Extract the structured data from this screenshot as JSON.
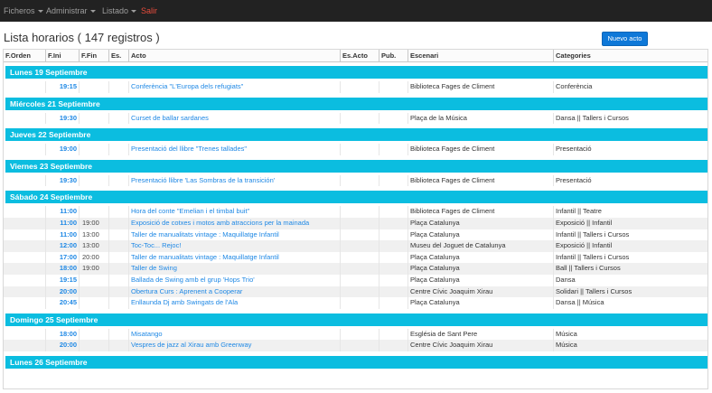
{
  "navbar": {
    "items": [
      {
        "label": "Ficheros",
        "dropdown": true
      },
      {
        "label": "Administrar",
        "dropdown": true
      },
      {
        "label": "Listado",
        "dropdown": true
      },
      {
        "label": "Salir",
        "dropdown": false
      }
    ]
  },
  "page": {
    "title": "Lista horarios ( 147 registros )",
    "new_button": "Nuevo acto"
  },
  "table": {
    "headers": [
      "F.Orden",
      "F.Ini",
      "F.Fin",
      "Es.",
      "Acto",
      "Es.Acto",
      "Pub.",
      "Escenari",
      "Categories"
    ],
    "groups": [
      {
        "day": "Lunes 19 Septiembre",
        "rows": [
          {
            "ini": "19:15",
            "fin": "",
            "acto": "Conferència \"L'Europa dels refugiats\"",
            "escenari": "Biblioteca Fages de Climent",
            "categories": "Conferència"
          }
        ]
      },
      {
        "day": "Miércoles 21 Septiembre",
        "rows": [
          {
            "ini": "19:30",
            "fin": "",
            "acto": "Curset de ballar sardanes",
            "escenari": "Plaça de la Música",
            "categories": "Dansa || Tallers i Cursos"
          }
        ]
      },
      {
        "day": "Jueves 22 Septiembre",
        "rows": [
          {
            "ini": "19:00",
            "fin": "",
            "acto": "Presentació del llibre \"Trenes tallades\"",
            "escenari": "Biblioteca Fages de Climent",
            "categories": "Presentació"
          }
        ]
      },
      {
        "day": "Viernes 23 Septiembre",
        "rows": [
          {
            "ini": "19:30",
            "fin": "",
            "acto": "Presentació llibre 'Las Sombras de la transición'",
            "escenari": "Biblioteca Fages de Climent",
            "categories": "Presentació"
          }
        ]
      },
      {
        "day": "Sábado 24 Septiembre",
        "rows": [
          {
            "ini": "11:00",
            "fin": "",
            "acto": "Hora del conte \"Emelian i el timbal buit\"",
            "escenari": "Biblioteca Fages de Climent",
            "categories": "Infantil || Teatre"
          },
          {
            "ini": "11:00",
            "fin": "19:00",
            "acto": "Exposició de cotxes i motos amb atraccions per la mainada",
            "escenari": "Plaça Catalunya",
            "categories": "Exposició || Infantil"
          },
          {
            "ini": "11:00",
            "fin": "13:00",
            "acto": "Taller de manualitats vintage : Maquillatge Infantil",
            "escenari": "Plaça Catalunya",
            "categories": "Infantil || Tallers i Cursos"
          },
          {
            "ini": "12:00",
            "fin": "13:00",
            "acto": "Toc-Toc... Rejoc!",
            "escenari": "Museu del Joguet de Catalunya",
            "categories": "Exposició || Infantil"
          },
          {
            "ini": "17:00",
            "fin": "20:00",
            "acto": "Taller de manualitats vintage : Maquillatge Infantil",
            "escenari": "Plaça Catalunya",
            "categories": "Infantil || Tallers i Cursos"
          },
          {
            "ini": "18:00",
            "fin": "19:00",
            "acto": "Taller de Swing",
            "escenari": "Plaça Catalunya",
            "categories": "Ball || Tallers i Cursos"
          },
          {
            "ini": "19:15",
            "fin": "",
            "acto": "Ballada de Swing amb el grup 'Hops Trio'",
            "escenari": "Plaça Catalunya",
            "categories": "Dansa"
          },
          {
            "ini": "20:00",
            "fin": "",
            "acto": "Obertura Curs : Aprenent a Cooperar",
            "escenari": "Centre Cívic Joaquim Xirau",
            "categories": "Solidari || Tallers i Cursos"
          },
          {
            "ini": "20:45",
            "fin": "",
            "acto": "Enllaunda Dj amb Swingats de l'Ala",
            "escenari": "Plaça Catalunya",
            "categories": "Dansa || Música"
          }
        ]
      },
      {
        "day": "Domingo 25 Septiembre",
        "rows": [
          {
            "ini": "18:00",
            "fin": "",
            "acto": "Misatango",
            "escenari": "Església de Sant Pere",
            "categories": "Música"
          },
          {
            "ini": "20:00",
            "fin": "",
            "acto": "Vespres de jazz al Xirau amb Greenway",
            "escenari": "Centre Cívic Joaquim Xirau",
            "categories": "Música"
          }
        ]
      },
      {
        "day": "Lunes 26 Septiembre",
        "rows": []
      }
    ]
  },
  "colors": {
    "navbar_bg": "#222222",
    "day_band": "#0bbde0",
    "link": "#1e88e5",
    "primary_button": "#0e78d8",
    "salir": "#e74c3c"
  }
}
